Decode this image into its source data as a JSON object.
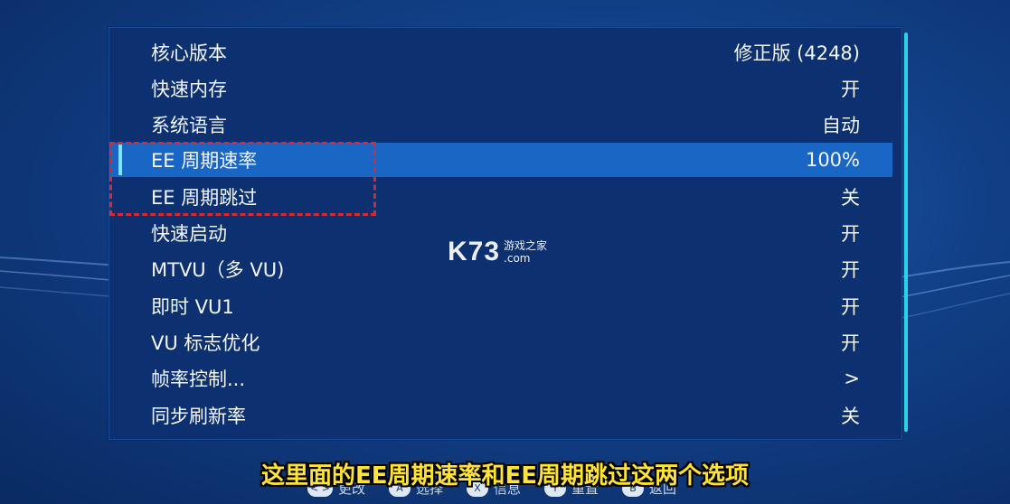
{
  "settings": {
    "rows": [
      {
        "label": "核心版本",
        "value": "修正版 (4248)"
      },
      {
        "label": "快速内存",
        "value": "开"
      },
      {
        "label": "系统语言",
        "value": "自动"
      },
      {
        "label": "EE 周期速率",
        "value": "100%"
      },
      {
        "label": "EE 周期跳过",
        "value": "关"
      },
      {
        "label": "快速启动",
        "value": "开"
      },
      {
        "label": "MTVU（多 VU)",
        "value": "开"
      },
      {
        "label": "即时 VU1",
        "value": "开"
      },
      {
        "label": "VU 标志优化",
        "value": "开"
      },
      {
        "label": "帧率控制...",
        "value": ">"
      },
      {
        "label": "同步刷新率",
        "value": "关"
      }
    ],
    "selected_index": 3
  },
  "watermark": {
    "big": "K73",
    "line1": "游戏之家",
    "line2": ".com"
  },
  "footer": {
    "items": [
      {
        "button": "< >",
        "label": "更改"
      },
      {
        "button": "A",
        "label": "选择"
      },
      {
        "button": "X",
        "label": "信息"
      },
      {
        "button": "Y",
        "label": "重置"
      },
      {
        "button": "B",
        "label": "返回"
      }
    ]
  },
  "subtitle": "这里面的EE周期速率和EE周期跳过这两个选项",
  "colors": {
    "accent": "#2fd0e8",
    "selected_row": "#1a66c4",
    "highlight_box": "#e0262a",
    "subtitle": "#ffe33a"
  }
}
